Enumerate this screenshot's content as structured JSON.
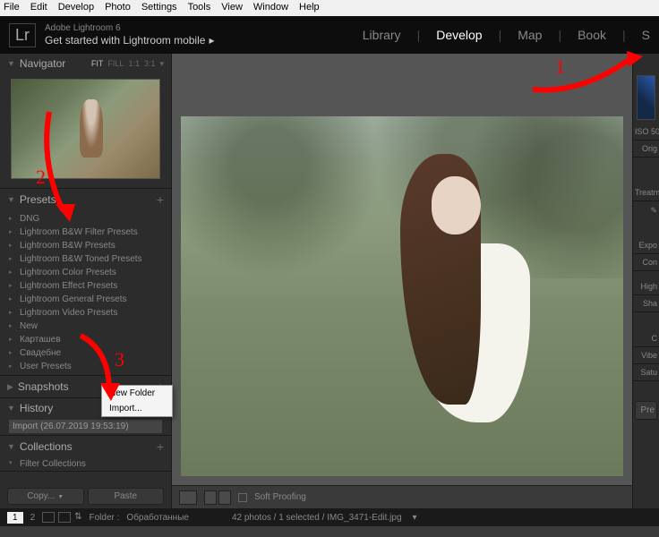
{
  "menubar": [
    "File",
    "Edit",
    "Develop",
    "Photo",
    "Settings",
    "Tools",
    "View",
    "Window",
    "Help"
  ],
  "header": {
    "logo": "Lr",
    "subtitle": "Adobe Lightroom 6",
    "tagline": "Get started with Lightroom mobile",
    "modules": {
      "library": "Library",
      "develop": "Develop",
      "map": "Map",
      "book": "Book",
      "more": "S"
    }
  },
  "navigator": {
    "title": "Navigator",
    "tabs": {
      "fit": "FIT",
      "fill": "FILL",
      "z1": "1:1",
      "z2": "3:1"
    }
  },
  "presets": {
    "title": "Presets",
    "items": [
      "DNG",
      "Lightroom B&W Filter Presets",
      "Lightroom B&W Presets",
      "Lightroom B&W Toned Presets",
      "Lightroom Color Presets",
      "Lightroom Effect Presets",
      "Lightroom General Presets",
      "Lightroom Video Presets",
      "New",
      "Карташев",
      "Свадебне",
      "User Presets"
    ]
  },
  "snapshots": {
    "title": "Snapshots"
  },
  "history": {
    "title": "History",
    "item": "Import (26.07.2019 19:53:19)"
  },
  "collections": {
    "title": "Collections",
    "filter": "Filter Collections"
  },
  "buttons": {
    "copy": "Copy...",
    "paste": "Paste"
  },
  "context": {
    "newfolder": "New Folder",
    "import": "Import..."
  },
  "toolbar": {
    "softproof": "Soft Proofing"
  },
  "rightpanel": {
    "iso": "ISO 50",
    "orig": "Orig",
    "treat": "Treatme",
    "expo": "Expo",
    "cont": "Con",
    "high": "High",
    "sha": "Sha",
    "cla": "C",
    "vibe": "Vibe",
    "satu": "Satu",
    "pre": "Pre"
  },
  "statusbar": {
    "page": "1",
    "page2": "2",
    "folder_label": "Folder :",
    "folder_name": "Обработанные",
    "info": "42 photos / 1 selected / IMG_3471-Edit.jpg"
  },
  "annotations": {
    "a1": "1",
    "a2": "2",
    "a3": "3"
  }
}
